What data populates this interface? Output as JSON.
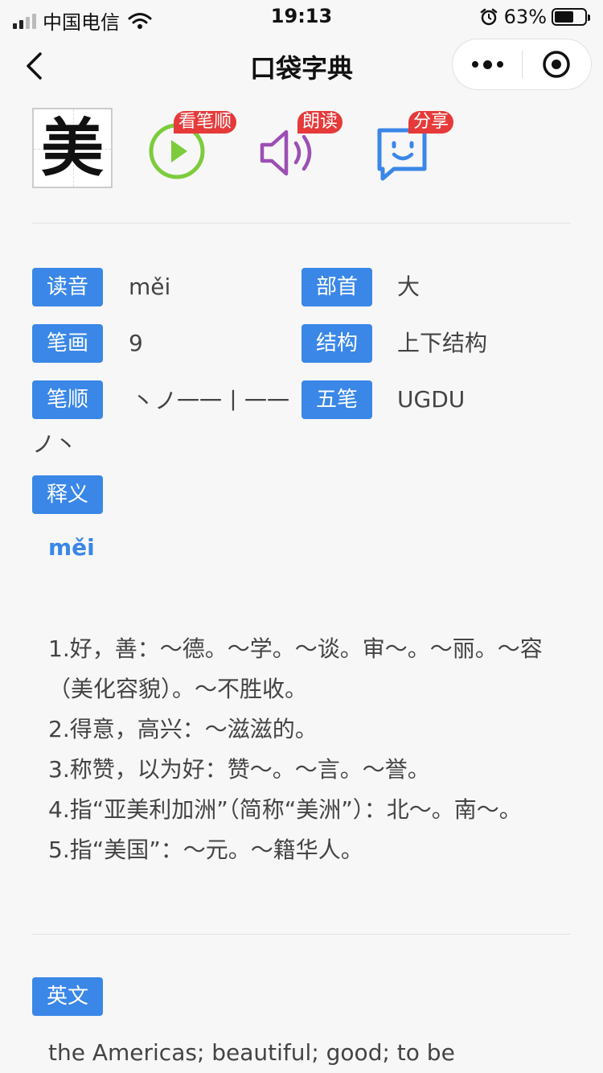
{
  "status_bar": {
    "carrier": "中国电信",
    "time": "19:13",
    "battery_percent": "63%",
    "battery_level": 0.63
  },
  "nav": {
    "title": "口袋字典"
  },
  "character": {
    "glyph": "美"
  },
  "actions": {
    "stroke_order_badge": "看笔顺",
    "read_badge": "朗读",
    "share_badge": "分享",
    "stroke_order_color": "#7ccc3c",
    "read_color": "#9c4fb5",
    "share_color": "#3a87e8"
  },
  "info": {
    "pinyin_label": "读音",
    "pinyin_value": "měi",
    "radical_label": "部首",
    "radical_value": "大",
    "strokes_label": "笔画",
    "strokes_value": "9",
    "structure_label": "结构",
    "structure_value": "上下结构",
    "stroke_order_label": "笔顺",
    "stroke_order_value": "丶ノ一一丨一一ノ丶",
    "wubi_label": "五笔",
    "wubi_value": "UGDU"
  },
  "meaning": {
    "label": "释义",
    "pinyin": "měi",
    "definitions": [
      "1.好，善：～德。～学。～谈。审～。～丽。～容（美化容貌）。～不胜收。",
      "2.得意，高兴：～滋滋的。",
      "3.称赞，以为好：赞～。～言。～誉。",
      "4.指“亚美利加洲”（简称“美洲”）：北～。南～。",
      "5.指“美国”：～元。～籍华人。"
    ]
  },
  "english": {
    "label": "英文",
    "text": "the Americas; beautiful; good; to be"
  },
  "colors": {
    "accent": "#3a87e8",
    "badge": "#e63a3a"
  }
}
